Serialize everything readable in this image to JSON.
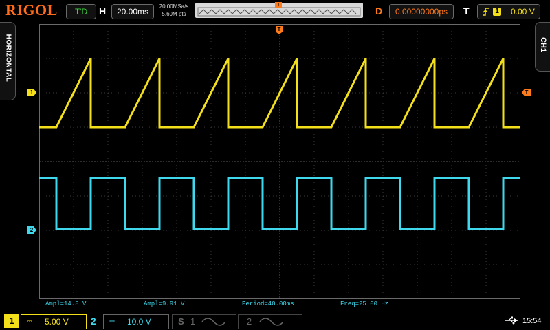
{
  "brand": "RIGOL",
  "status": {
    "run_state": "T'D"
  },
  "horizontal": {
    "label": "H",
    "timebase": "20.00ms",
    "sample_rate": "20.00MSa/s",
    "memory_depth": "5.60M pts"
  },
  "delay": {
    "label": "D",
    "value": "0.00000000ps"
  },
  "trigger": {
    "label": "T",
    "source": "1",
    "level": "0.00 V"
  },
  "side_tabs": {
    "left": "HORIZONTAL",
    "right": "CH1"
  },
  "markers": {
    "ch1": "1",
    "ch2": "2",
    "trigger": "T"
  },
  "measurements": [
    {
      "text": "Ampl=14.8 V"
    },
    {
      "text": "Ampl=9.91 V"
    },
    {
      "text": "Period=40.00ms"
    },
    {
      "text": "Freq=25.00 Hz"
    }
  ],
  "channels": {
    "ch1": {
      "number": "1",
      "scale": "5.00 V",
      "color": "#f4e01a"
    },
    "ch2": {
      "number": "2",
      "scale": "10.0 V",
      "color": "#3fd8ec"
    },
    "s1": {
      "label": "S",
      "number": "1"
    },
    "s2": {
      "number": "2"
    }
  },
  "clock": "15:54",
  "colors": {
    "accent": "#ff6b1a",
    "trigger": "#ff7a1a"
  }
}
